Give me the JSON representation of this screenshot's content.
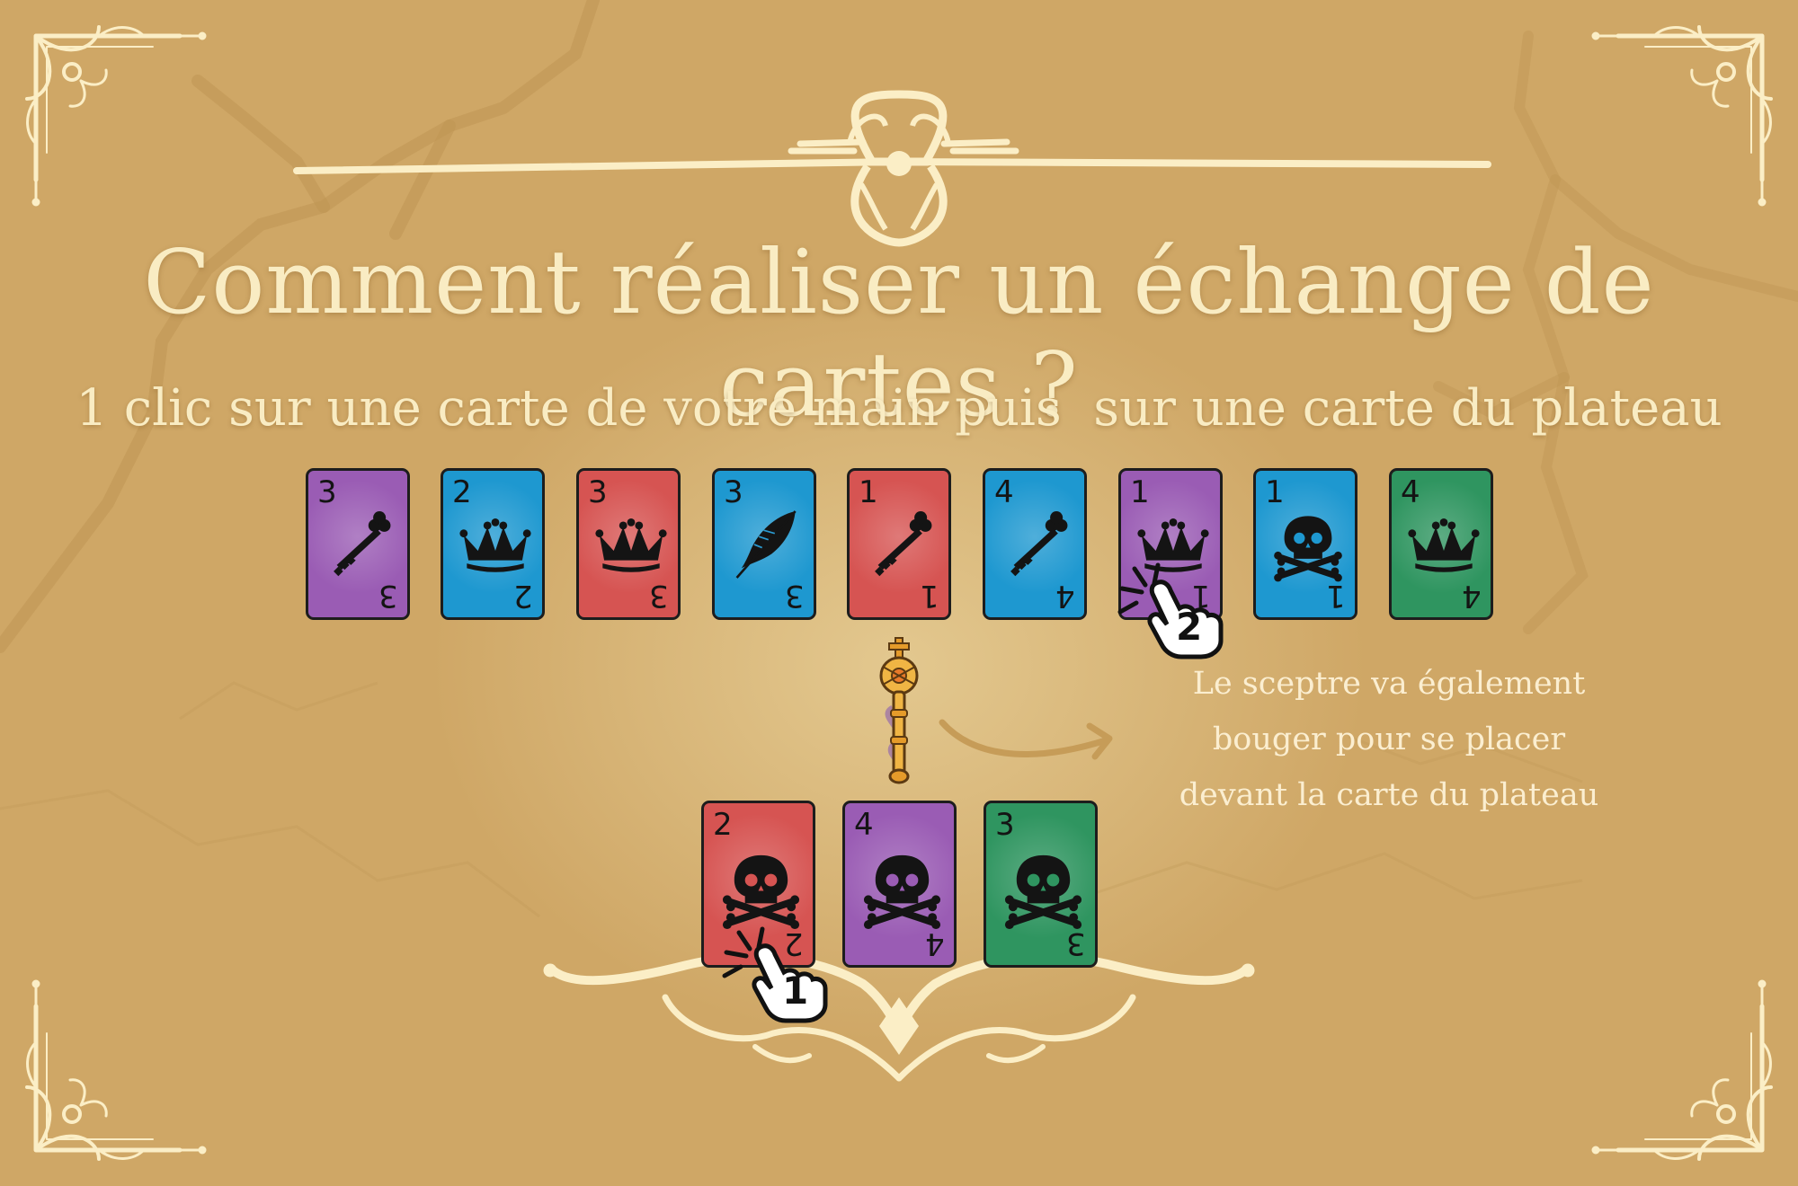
{
  "title": "Comment réaliser un échange de cartes ?",
  "subtitle": "1 clic sur une carte de votre main puis  sur une carte du plateau",
  "board_cards": [
    {
      "rank": "3",
      "symbol": "key",
      "color": "purple"
    },
    {
      "rank": "2",
      "symbol": "crown",
      "color": "blue"
    },
    {
      "rank": "3",
      "symbol": "crown",
      "color": "red"
    },
    {
      "rank": "3",
      "symbol": "feather",
      "color": "blue"
    },
    {
      "rank": "1",
      "symbol": "key",
      "color": "red"
    },
    {
      "rank": "4",
      "symbol": "key",
      "color": "blue"
    },
    {
      "rank": "1",
      "symbol": "crown",
      "color": "purple"
    },
    {
      "rank": "1",
      "symbol": "skull",
      "color": "blue"
    },
    {
      "rank": "4",
      "symbol": "crown",
      "color": "green"
    }
  ],
  "hand_cards": [
    {
      "rank": "2",
      "symbol": "skull",
      "color": "red"
    },
    {
      "rank": "4",
      "symbol": "skull",
      "color": "purple"
    },
    {
      "rank": "3",
      "symbol": "skull",
      "color": "green"
    }
  ],
  "card_colors": {
    "purple": "#9a5cb4",
    "blue": "#1e98d0",
    "red": "#d65452",
    "green": "#2f9560"
  },
  "step_markers": {
    "first": "1",
    "second": "2"
  },
  "note_lines": [
    "Le sceptre va également",
    "bouger pour se placer",
    "devant la carte du plateau"
  ],
  "icons": {
    "scepter": "scepter-icon",
    "arrow": "curved-arrow-icon",
    "pointer": "pointing-hand-icon"
  }
}
